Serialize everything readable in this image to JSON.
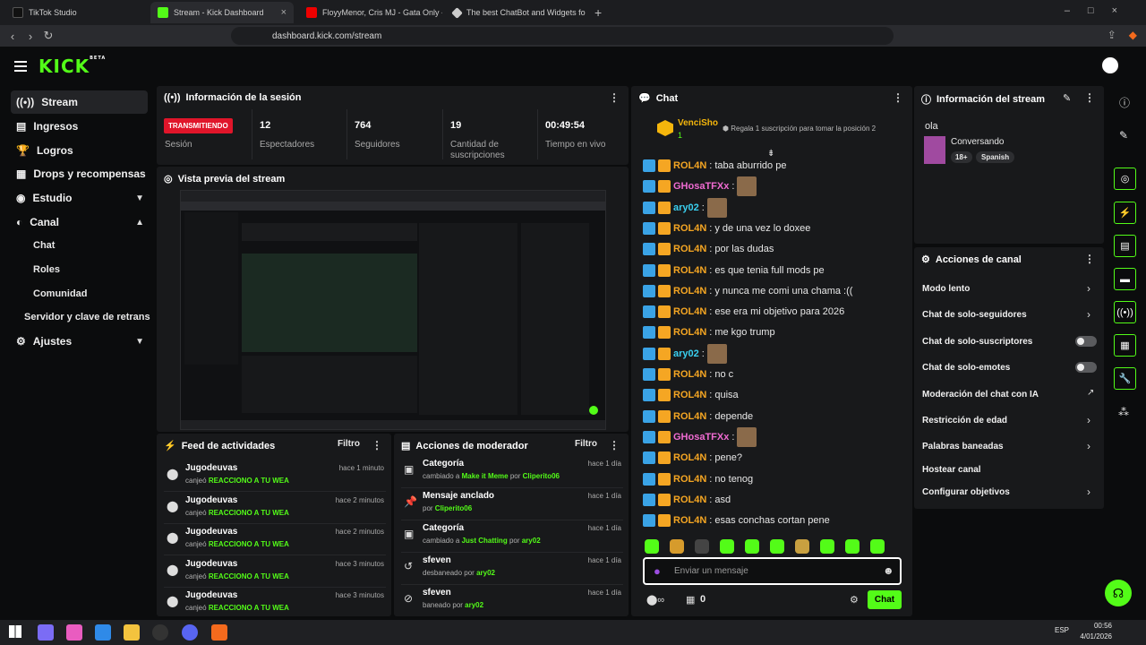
{
  "browser": {
    "tabs": [
      {
        "label": "TikTok Studio"
      },
      {
        "label": "Stream - Kick Dashboard"
      },
      {
        "label": "FloyyMenor, Cris MJ - Gata Only - Yo"
      },
      {
        "label": "The best ChatBot and Widgets fo"
      }
    ],
    "url": "dashboard.kick.com/stream"
  },
  "app": {
    "logo": "KICK",
    "logo_badge": "BETA"
  },
  "sidebar": {
    "items": [
      {
        "label": "Stream"
      },
      {
        "label": "Ingresos"
      },
      {
        "label": "Logros"
      },
      {
        "label": "Drops y recompensas"
      },
      {
        "label": "Estudio"
      },
      {
        "label": "Canal"
      },
      {
        "label": "Chat"
      },
      {
        "label": "Roles"
      },
      {
        "label": "Comunidad"
      },
      {
        "label": "Servidor y clave de retrans"
      },
      {
        "label": "Ajustes"
      }
    ]
  },
  "session": {
    "title": "Información de la sesión",
    "live_badge": "TRANSMITIENDO",
    "stats": [
      {
        "value": "",
        "label": "Sesión"
      },
      {
        "value": "12",
        "label": "Espectadores"
      },
      {
        "value": "764",
        "label": "Seguidores"
      },
      {
        "value": "19",
        "label": "Cantidad de suscripciones"
      },
      {
        "value": "00:49:54",
        "label": "Tiempo en vivo"
      }
    ]
  },
  "preview": {
    "title": "Vista previa del stream"
  },
  "activity": {
    "title": "Feed de actividades",
    "filter": "Filtro",
    "rows": [
      {
        "name": "Jugodeuvas",
        "action": "canjeó",
        "reward": "REACCIONO A TU WEA",
        "time": "hace 1 minuto"
      },
      {
        "name": "Jugodeuvas",
        "action": "canjeó",
        "reward": "REACCIONO A TU WEA",
        "time": "hace 2 minutos"
      },
      {
        "name": "Jugodeuvas",
        "action": "canjeó",
        "reward": "REACCIONO A TU WEA",
        "time": "hace 2 minutos"
      },
      {
        "name": "Jugodeuvas",
        "action": "canjeó",
        "reward": "REACCIONO A TU WEA",
        "time": "hace 3 minutos"
      },
      {
        "name": "Jugodeuvas",
        "action": "canjeó",
        "reward": "REACCIONO A TU WEA",
        "time": "hace 3 minutos"
      }
    ]
  },
  "modactions": {
    "title": "Acciones de moderador",
    "filter": "Filtro",
    "rows": [
      {
        "name": "Categoría",
        "pre": "cambiado a",
        "hl": "Make it Meme",
        "mid": "por",
        "by": "Cliperito06",
        "time": "hace 1 día"
      },
      {
        "name": "Mensaje anclado",
        "pre": "por",
        "hl": "Cliperito06",
        "mid": "",
        "by": "",
        "time": "hace 1 día"
      },
      {
        "name": "Categoría",
        "pre": "cambiado a",
        "hl": "Just Chatting",
        "mid": "por",
        "by": "ary02",
        "time": "hace 1 día"
      },
      {
        "name": "sfeven",
        "pre": "desbaneado por",
        "hl": "ary02",
        "mid": "",
        "by": "",
        "time": "hace 1 día"
      },
      {
        "name": "sfeven",
        "pre": "baneado por",
        "hl": "ary02",
        "mid": "",
        "by": "",
        "time": "hace 1 día"
      }
    ]
  },
  "chat": {
    "title": "Chat",
    "top_user": "VenciSho",
    "top_count": "1",
    "gift_text": "Regala 1 suscripción para tomar la posición 2",
    "messages": [
      {
        "user": "ROL4N",
        "text": "taba aburrido pe",
        "color": "#f5a623"
      },
      {
        "user": "GHosaTFXx",
        "text": "",
        "color": "#f06bd2"
      },
      {
        "user": "ary02",
        "text": "",
        "color": "#3ad0f0"
      },
      {
        "user": "ROL4N",
        "text": "y de una vez lo doxee",
        "color": "#f5a623"
      },
      {
        "user": "ROL4N",
        "text": "por las dudas",
        "color": "#f5a623"
      },
      {
        "user": "ROL4N",
        "text": "es que tenia full mods pe",
        "color": "#f5a623"
      },
      {
        "user": "ROL4N",
        "text": "y nunca me comi una chama :((",
        "color": "#f5a623"
      },
      {
        "user": "ROL4N",
        "text": "ese era mi objetivo para 2026",
        "color": "#f5a623"
      },
      {
        "user": "ROL4N",
        "text": "me kgo trump",
        "color": "#f5a623"
      },
      {
        "user": "ary02",
        "text": "",
        "color": "#3ad0f0"
      },
      {
        "user": "ROL4N",
        "text": "no c",
        "color": "#f5a623"
      },
      {
        "user": "ROL4N",
        "text": "quisa",
        "color": "#f5a623"
      },
      {
        "user": "ROL4N",
        "text": "depende",
        "color": "#f5a623"
      },
      {
        "user": "GHosaTFXx",
        "text": "",
        "color": "#f06bd2"
      },
      {
        "user": "ROL4N",
        "text": "pene?",
        "color": "#f5a623"
      },
      {
        "user": "ROL4N",
        "text": "no tenog",
        "color": "#f5a623"
      },
      {
        "user": "ROL4N",
        "text": "asd",
        "color": "#f5a623"
      },
      {
        "user": "ROL4N",
        "text": "esas conchas cortan pene",
        "color": "#f5a623"
      }
    ],
    "input_placeholder": "Enviar un mensaje",
    "points": "0",
    "send_label": "Chat"
  },
  "streaminfo": {
    "title": "Información del stream",
    "stream_title": "ola",
    "category": "Conversando",
    "tags": [
      "18+",
      "Spanish"
    ]
  },
  "channel": {
    "title": "Acciones de canal",
    "actions": [
      {
        "label": "Modo lento",
        "kind": "chevron"
      },
      {
        "label": "Chat de solo-seguidores",
        "kind": "chevron"
      },
      {
        "label": "Chat de solo-suscriptores",
        "kind": "toggle"
      },
      {
        "label": "Chat de solo-emotes",
        "kind": "toggle"
      },
      {
        "label": "Moderación del chat con IA",
        "kind": "external"
      },
      {
        "label": "Restricción de edad",
        "kind": "chevron"
      },
      {
        "label": "Palabras baneadas",
        "kind": "chevron"
      },
      {
        "label": "Hostear canal",
        "kind": "none"
      },
      {
        "label": "Configurar objetivos",
        "kind": "chevron"
      }
    ]
  },
  "taskbar": {
    "lang": "ESP",
    "time": "00:56",
    "date": "4/01/2026"
  },
  "colors": {
    "accent": "#53fc18",
    "live": "#e0152a",
    "panel": "#18191b",
    "bg": "#0b0c0d"
  }
}
